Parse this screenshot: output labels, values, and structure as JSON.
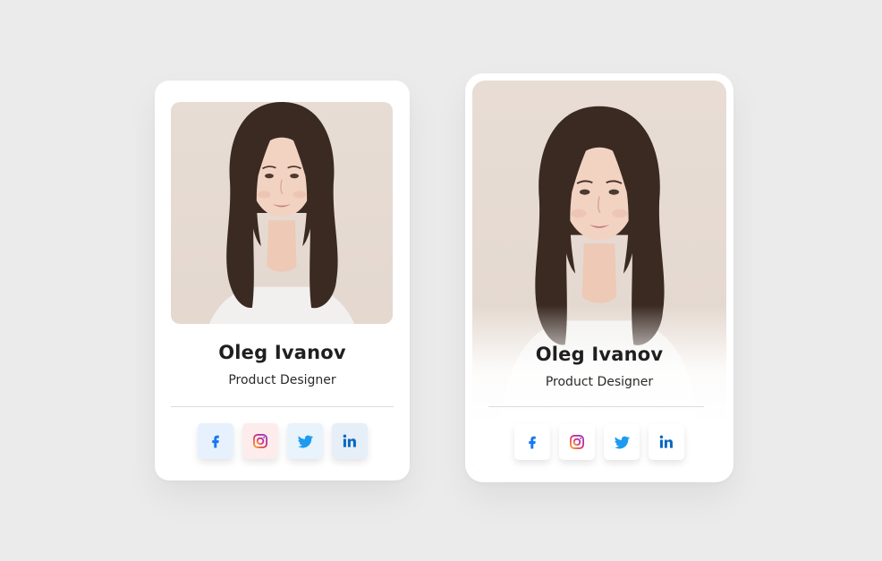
{
  "colors": {
    "background": "#ebebeb",
    "card": "#ffffff",
    "photo_backdrop": "#e6dbd3",
    "facebook": "#1877f2",
    "instagram": "#e1306c",
    "twitter": "#1d9bf0",
    "linkedin": "#0a66c2"
  },
  "cards": [
    {
      "name": "Oleg Ivanov",
      "role": "Product Designer",
      "socials": [
        {
          "icon": "facebook-icon"
        },
        {
          "icon": "instagram-icon"
        },
        {
          "icon": "twitter-icon"
        },
        {
          "icon": "linkedin-icon"
        }
      ]
    },
    {
      "name": "Oleg Ivanov",
      "role": "Product Designer",
      "socials": [
        {
          "icon": "facebook-icon"
        },
        {
          "icon": "instagram-icon"
        },
        {
          "icon": "twitter-icon"
        },
        {
          "icon": "linkedin-icon"
        }
      ]
    }
  ]
}
